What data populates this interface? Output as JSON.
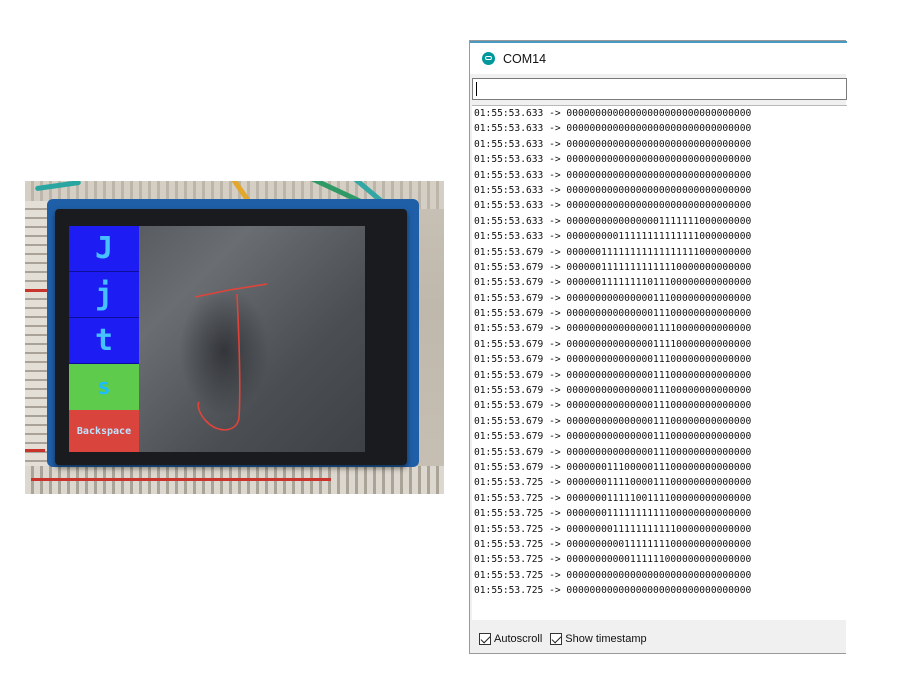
{
  "photo": {
    "buttons": [
      {
        "label": "J",
        "style": "blue"
      },
      {
        "label": "j",
        "style": "blue"
      },
      {
        "label": "t",
        "style": "blue"
      },
      {
        "label": "s",
        "style": "green"
      },
      {
        "label": "Backspace",
        "style": "red"
      }
    ]
  },
  "serial_monitor": {
    "title": "COM14",
    "send_input_value": "",
    "lines": [
      {
        "time": "01:55:53.633",
        "bits": "00000000000000000000000000000000"
      },
      {
        "time": "01:55:53.633",
        "bits": "00000000000000000000000000000000"
      },
      {
        "time": "01:55:53.633",
        "bits": "00000000000000000000000000000000"
      },
      {
        "time": "01:55:53.633",
        "bits": "00000000000000000000000000000000"
      },
      {
        "time": "01:55:53.633",
        "bits": "00000000000000000000000000000000"
      },
      {
        "time": "01:55:53.633",
        "bits": "00000000000000000000000000000000"
      },
      {
        "time": "01:55:53.633",
        "bits": "00000000000000000000000000000000"
      },
      {
        "time": "01:55:53.633",
        "bits": "00000000000000001111111000000000"
      },
      {
        "time": "01:55:53.633",
        "bits": "00000000011111111111111000000000"
      },
      {
        "time": "01:55:53.679",
        "bits": "00000011111111111111111000000000"
      },
      {
        "time": "01:55:53.679",
        "bits": "00000011111111111110000000000000"
      },
      {
        "time": "01:55:53.679",
        "bits": "00000011111111011100000000000000"
      },
      {
        "time": "01:55:53.679",
        "bits": "00000000000000011100000000000000"
      },
      {
        "time": "01:55:53.679",
        "bits": "00000000000000011100000000000000"
      },
      {
        "time": "01:55:53.679",
        "bits": "00000000000000011110000000000000"
      },
      {
        "time": "01:55:53.679",
        "bits": "00000000000000011110000000000000"
      },
      {
        "time": "01:55:53.679",
        "bits": "00000000000000011100000000000000"
      },
      {
        "time": "01:55:53.679",
        "bits": "00000000000000011100000000000000"
      },
      {
        "time": "01:55:53.679",
        "bits": "00000000000000011100000000000000"
      },
      {
        "time": "01:55:53.679",
        "bits": "00000000000000011100000000000000"
      },
      {
        "time": "01:55:53.679",
        "bits": "00000000000000011100000000000000"
      },
      {
        "time": "01:55:53.679",
        "bits": "00000000000000011100000000000000"
      },
      {
        "time": "01:55:53.679",
        "bits": "00000000000000011100000000000000"
      },
      {
        "time": "01:55:53.679",
        "bits": "00000001110000011100000000000000"
      },
      {
        "time": "01:55:53.725",
        "bits": "00000001111000011100000000000000"
      },
      {
        "time": "01:55:53.725",
        "bits": "00000001111100111100000000000000"
      },
      {
        "time": "01:55:53.725",
        "bits": "00000001111111111100000000000000"
      },
      {
        "time": "01:55:53.725",
        "bits": "00000000111111111110000000000000"
      },
      {
        "time": "01:55:53.725",
        "bits": "00000000001111111100000000000000"
      },
      {
        "time": "01:55:53.725",
        "bits": "00000000000111111000000000000000"
      },
      {
        "time": "01:55:53.725",
        "bits": "00000000000000000000000000000000"
      },
      {
        "time": "01:55:53.725",
        "bits": "00000000000000000000000000000000"
      }
    ],
    "autoscroll_label": "Autoscroll",
    "show_timestamp_label": "Show timestamp"
  }
}
